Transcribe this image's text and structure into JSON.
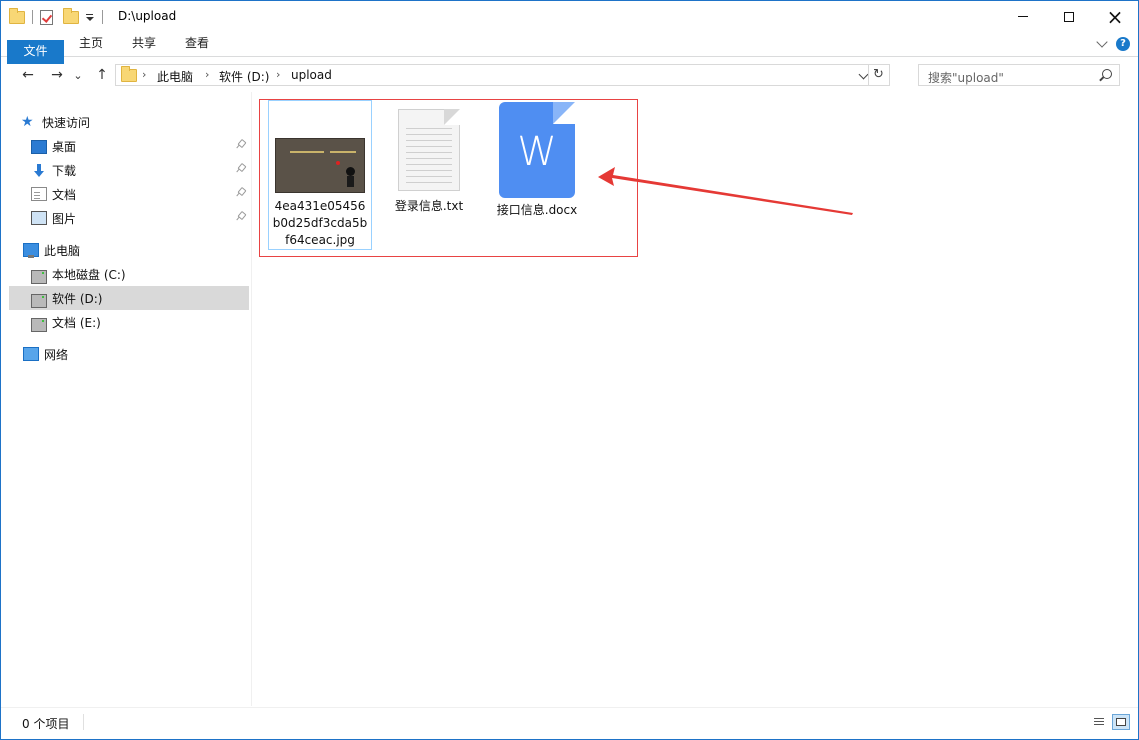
{
  "window": {
    "title": "D:\\upload",
    "controls": {
      "minimize": "minimize-icon",
      "maximize": "maximize-icon",
      "close": "×"
    }
  },
  "ribbon": {
    "tabs": [
      {
        "label": "文件",
        "active": true
      },
      {
        "label": "主页"
      },
      {
        "label": "共享"
      },
      {
        "label": "查看"
      }
    ],
    "help": "?"
  },
  "nav": {
    "back": "←",
    "forward": "→",
    "recent": "⌄",
    "up": "↑",
    "breadcrumb": [
      "此电脑",
      "软件 (D:)",
      "upload"
    ],
    "refresh": "↻",
    "search_placeholder": "搜索\"upload\""
  },
  "sidebar": {
    "quick_access": "快速访问",
    "pinned": [
      {
        "label": "桌面",
        "icon": "desktop-icon"
      },
      {
        "label": "下载",
        "icon": "download-icon"
      },
      {
        "label": "文档",
        "icon": "documents-icon"
      },
      {
        "label": "图片",
        "icon": "pictures-icon"
      }
    ],
    "this_pc": "此电脑",
    "drives": [
      {
        "label": "本地磁盘 (C:)",
        "selected": false
      },
      {
        "label": "软件 (D:)",
        "selected": true
      },
      {
        "label": "文档 (E:)",
        "selected": false
      }
    ],
    "network": "网络"
  },
  "files": [
    {
      "name": "4ea431e05456b0d25df3cda5bf64ceac.jpg",
      "type": "jpg"
    },
    {
      "name": "登录信息.txt",
      "type": "txt"
    },
    {
      "name": "接口信息.docx",
      "type": "docx",
      "glyph": "W"
    }
  ],
  "status": {
    "items": "0 个项目"
  },
  "colors": {
    "accent": "#1979ca",
    "highlight": "#e84343",
    "docx": "#4f8ef2"
  }
}
